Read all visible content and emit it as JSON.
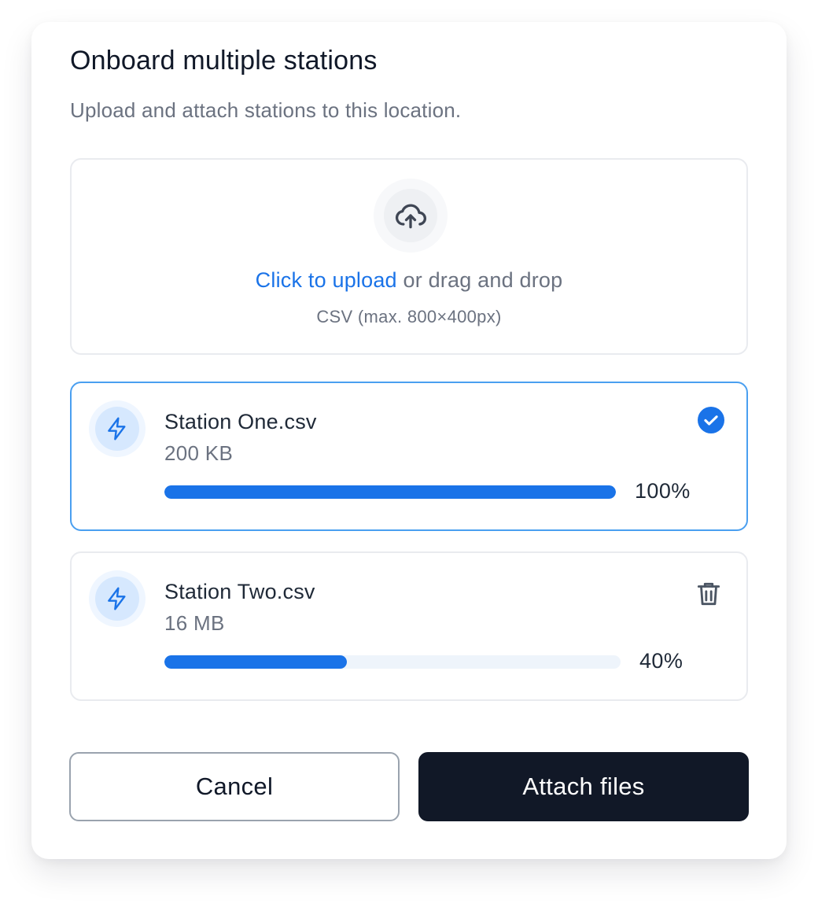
{
  "dialog": {
    "title": "Onboard multiple stations",
    "subtitle": "Upload and attach stations to this location."
  },
  "upload": {
    "icon": "cloud-upload-icon",
    "link_text": "Click to upload",
    "rest_text": " or drag and drop",
    "hint": "CSV (max. 800×400px)"
  },
  "files": [
    {
      "name": "Station One.csv",
      "size": "200 KB",
      "progress": 100,
      "progress_label": "100%",
      "status": "complete",
      "icon": "lightning-icon"
    },
    {
      "name": "Station Two.csv",
      "size": "16 MB",
      "progress": 40,
      "progress_label": "40%",
      "status": "uploading",
      "icon": "lightning-icon"
    }
  ],
  "actions": {
    "cancel_label": "Cancel",
    "confirm_label": "Attach files"
  },
  "colors": {
    "accent": "#1a73e8",
    "primary_button": "#111827",
    "active_border": "#4a9ff0"
  }
}
